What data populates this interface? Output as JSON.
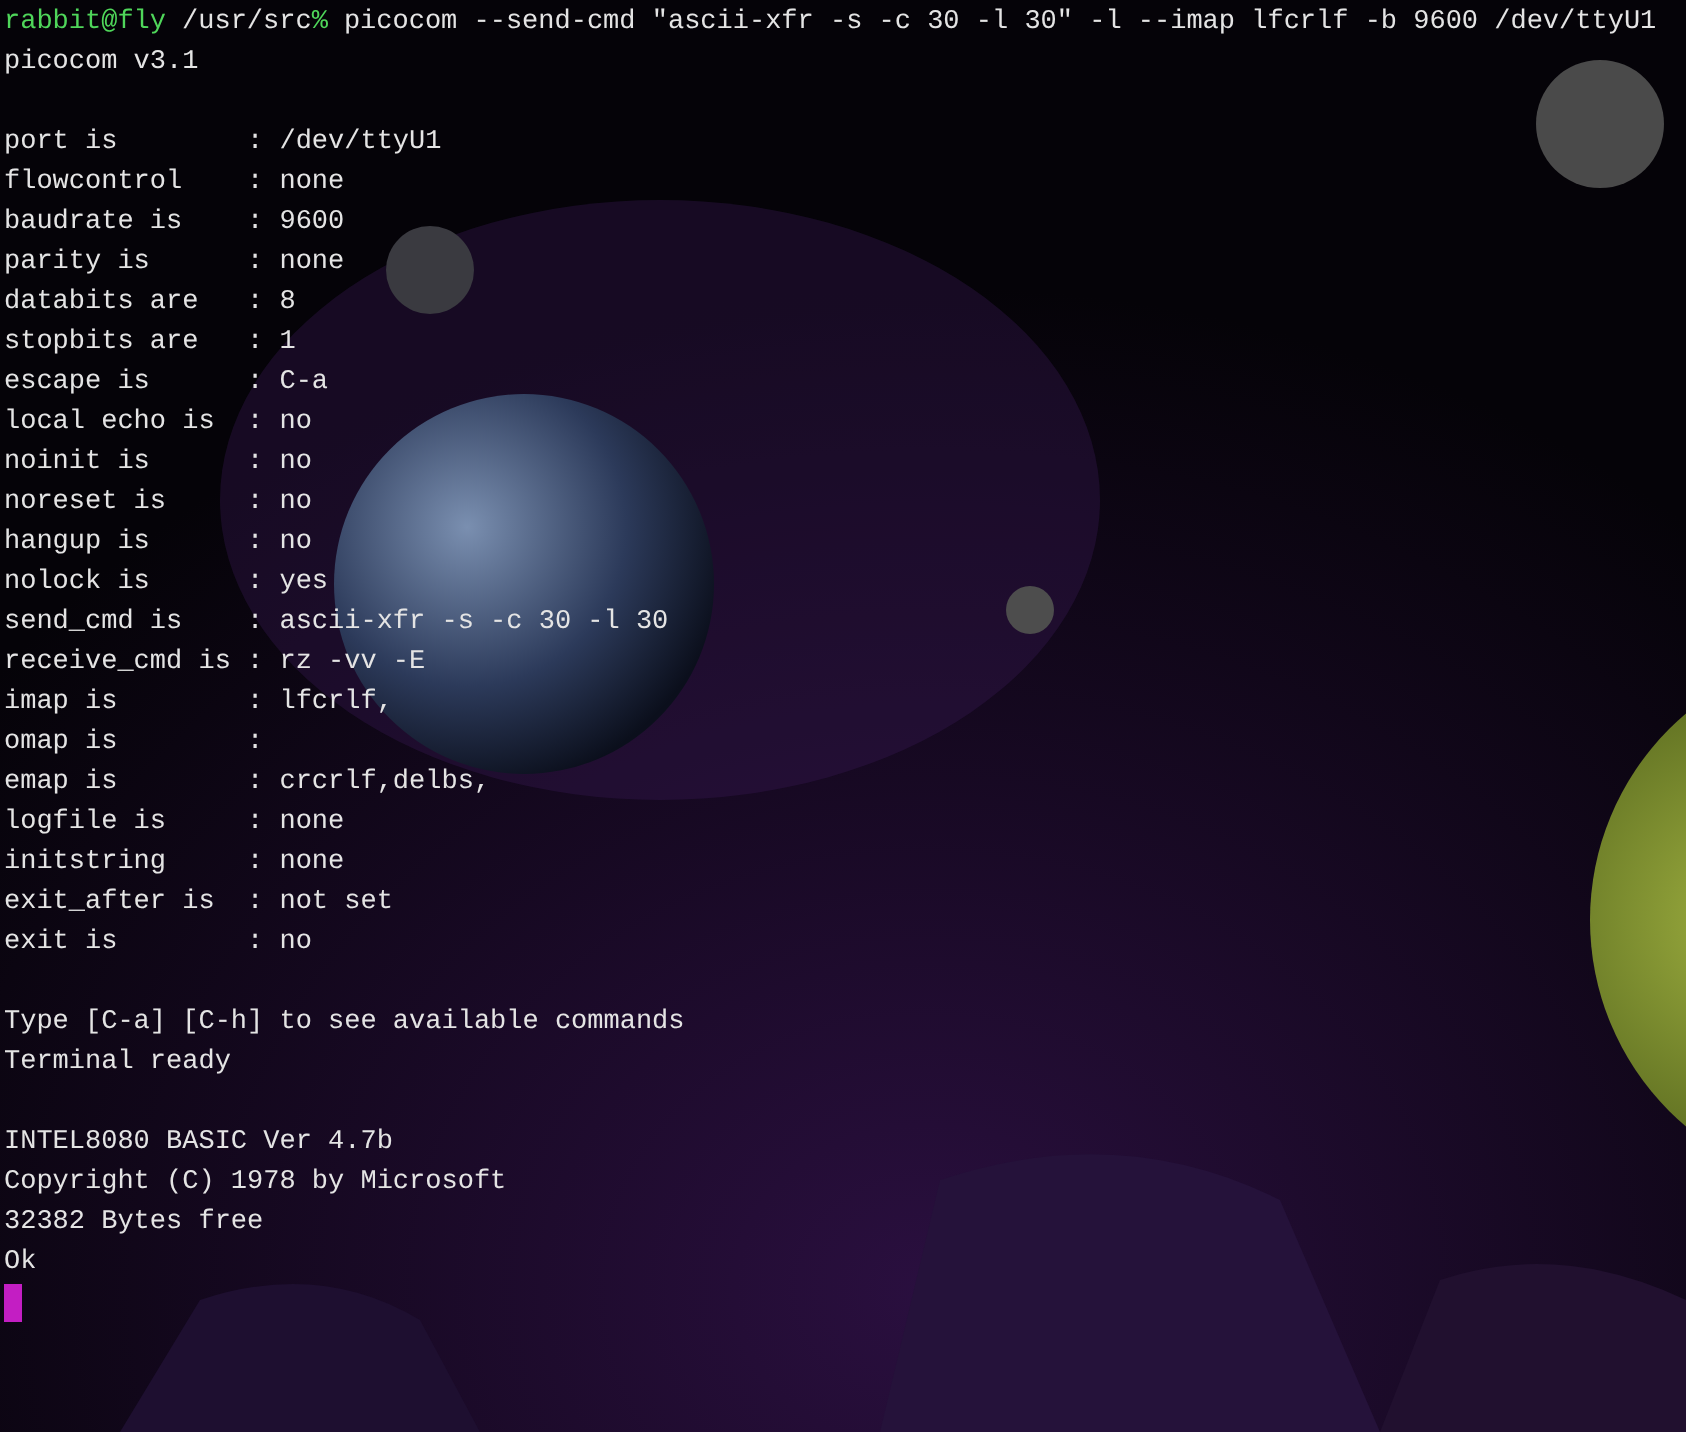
{
  "prompt": {
    "user_host": "rabbit@fly",
    "path": "/usr/src",
    "symbol": "%",
    "command": "picocom --send-cmd \"ascii-xfr -s -c 30 -l 30\" -l --imap lfcrlf -b 9600 /dev/ttyU1"
  },
  "blocks": [
    [
      "picocom v3.1"
    ],
    [
      "port is        : /dev/ttyU1",
      "flowcontrol    : none",
      "baudrate is    : 9600",
      "parity is      : none",
      "databits are   : 8",
      "stopbits are   : 1",
      "escape is      : C-a",
      "local echo is  : no",
      "noinit is      : no",
      "noreset is     : no",
      "hangup is      : no",
      "nolock is      : yes",
      "send_cmd is    : ascii-xfr -s -c 30 -l 30",
      "receive_cmd is : rz -vv -E",
      "imap is        : lfcrlf,",
      "omap is        :",
      "emap is        : crcrlf,delbs,",
      "logfile is     : none",
      "initstring     : none",
      "exit_after is  : not set",
      "exit is        : no"
    ],
    [
      "Type [C-a] [C-h] to see available commands",
      "Terminal ready"
    ],
    [
      "INTEL8080 BASIC Ver 4.7b",
      "Copyright (C) 1978 by Microsoft",
      "32382 Bytes free",
      "Ok"
    ]
  ]
}
